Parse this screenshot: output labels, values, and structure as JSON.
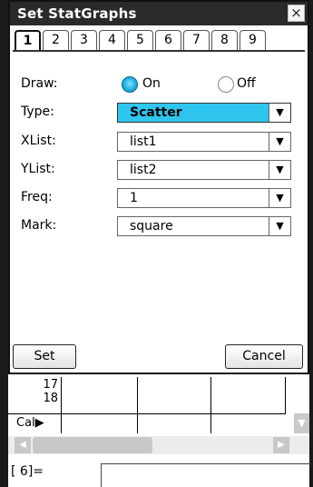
{
  "dialog": {
    "title": "Set StatGraphs",
    "close": "×",
    "tabs": [
      "1",
      "2",
      "3",
      "4",
      "5",
      "6",
      "7",
      "8",
      "9"
    ],
    "active_tab": "1",
    "draw": {
      "label": "Draw:",
      "on": "On",
      "off": "Off",
      "selected": "On"
    },
    "type": {
      "label": "Type:",
      "value": "Scatter"
    },
    "xlist": {
      "label": "XList:",
      "value": "list1"
    },
    "ylist": {
      "label": "YList:",
      "value": "list2"
    },
    "freq": {
      "label": "Freq:",
      "value": "1"
    },
    "mark": {
      "label": "Mark:",
      "value": "square"
    },
    "set_button": "Set",
    "cancel_button": "Cancel",
    "dropdown_arrow": "▼",
    "accent_color": "#2ec6ef"
  },
  "sheet": {
    "rows": [
      "17",
      "18"
    ],
    "cal_label": "Cal▶",
    "scroll_down": "▼"
  },
  "scrollbar": {
    "left": "◀",
    "right": "▶"
  },
  "entry": {
    "prompt": "[  6]="
  }
}
